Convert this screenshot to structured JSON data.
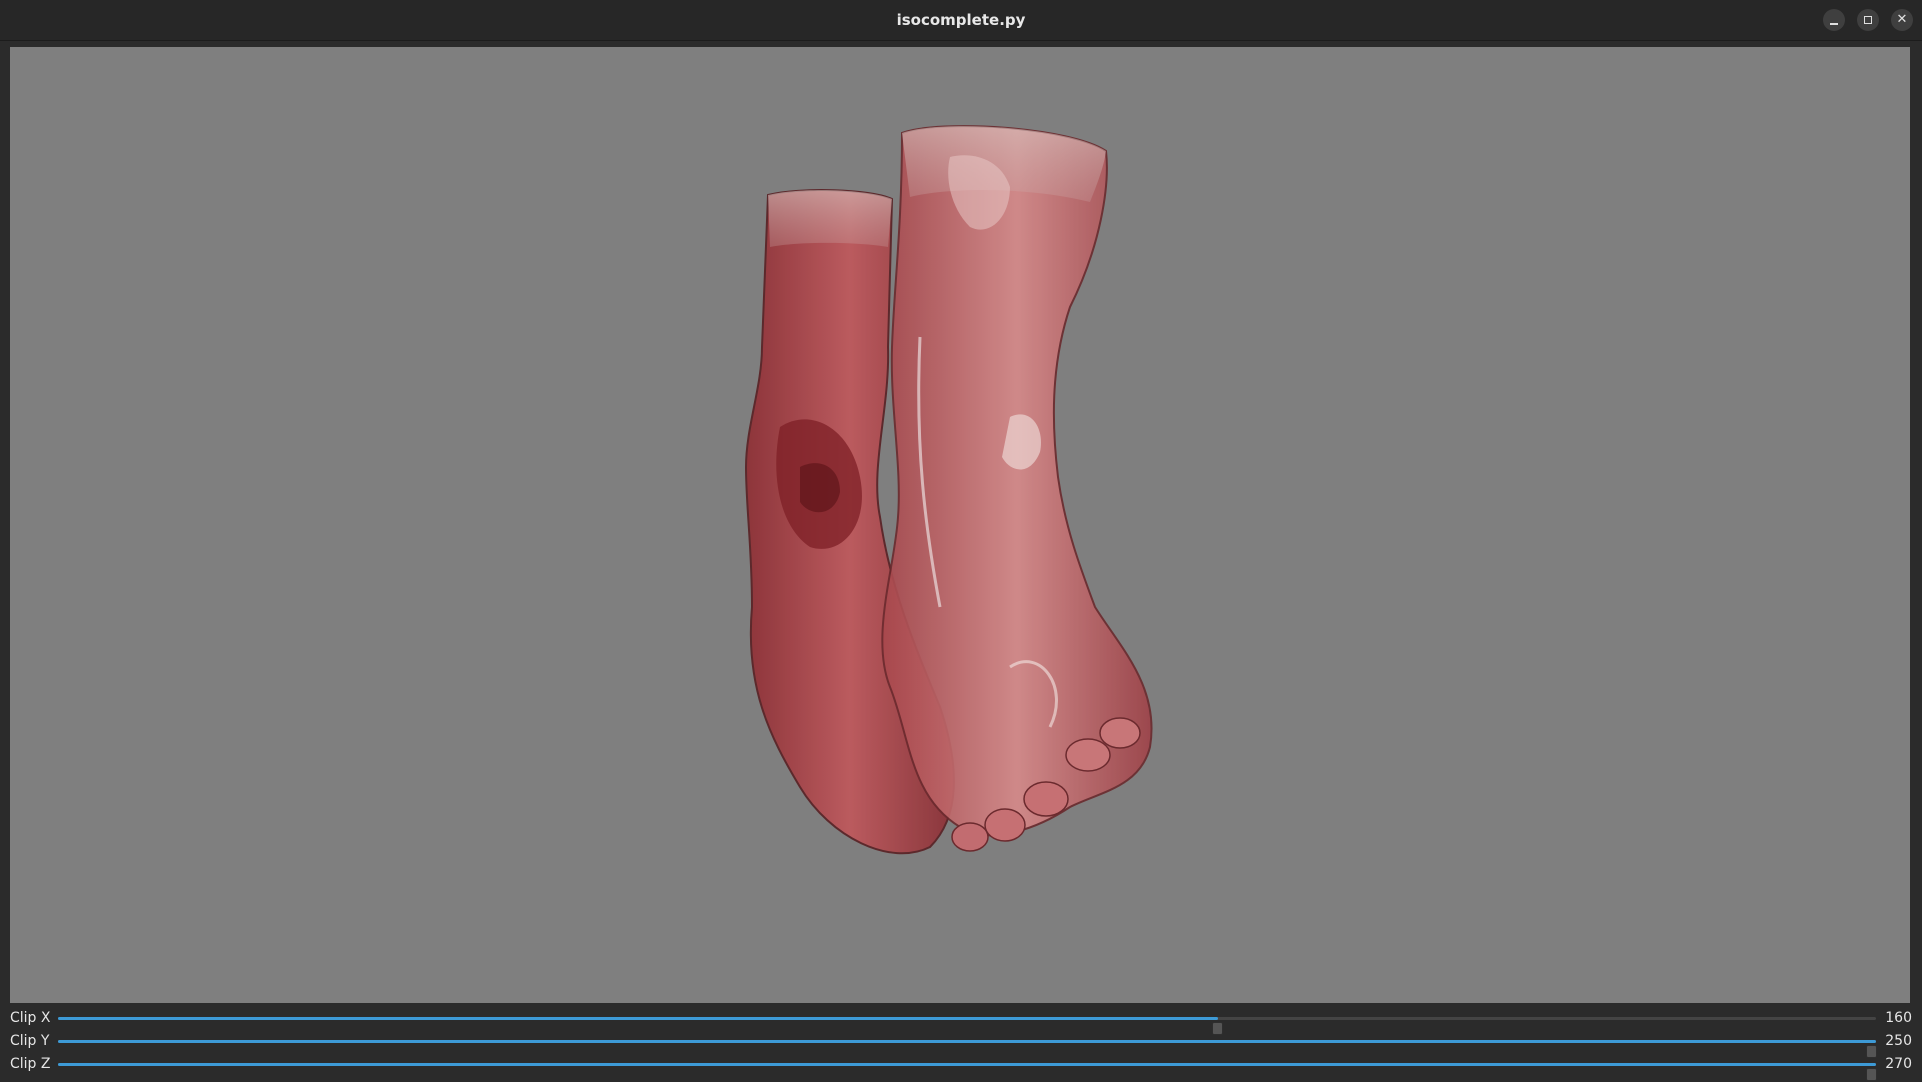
{
  "window": {
    "title": "isocomplete.py",
    "buttons": [
      "minimize-icon",
      "maximize-icon",
      "close-icon"
    ]
  },
  "viewport": {
    "background": "#7f7f7f",
    "content": "volume-rendering-icon"
  },
  "sliders": [
    {
      "label": "Clip X",
      "value": "160",
      "fraction": 0.65
    },
    {
      "label": "Clip Y",
      "value": "250",
      "fraction": 1.0
    },
    {
      "label": "Clip Z",
      "value": "270",
      "fraction": 1.0
    }
  ],
  "colors": {
    "accent": "#3d9ad6",
    "tissue": "#b34a4f",
    "skin": "#d9a3a3"
  }
}
